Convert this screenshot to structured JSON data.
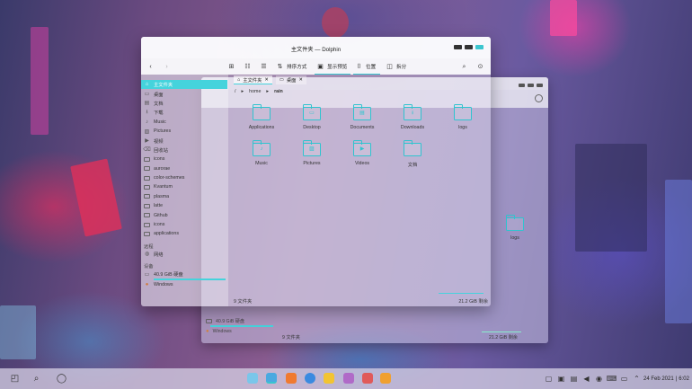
{
  "window": {
    "title": "主文件夹 — Dolphin",
    "controls": {
      "minimize": "minimize-icon",
      "maximize": "maximize-icon",
      "close": "close-icon"
    },
    "accent": "#45d3dc"
  },
  "toolbar": {
    "sort_label": "排序方式",
    "preview_label": "显示预览",
    "location_label": "位置",
    "split_label": "拆分"
  },
  "tabs": [
    {
      "label": "主文件夹"
    },
    {
      "label": "桌面"
    }
  ],
  "breadcrumb": {
    "root": "/",
    "items": [
      "home",
      "rain"
    ]
  },
  "sidebar": {
    "places": [
      {
        "label": "主文件夹",
        "icon": "home-icon",
        "active": true
      },
      {
        "label": "桌面",
        "icon": "desktop-icon"
      },
      {
        "label": "文档",
        "icon": "document-icon"
      },
      {
        "label": "下载",
        "icon": "download-icon"
      },
      {
        "label": "Music",
        "icon": "music-icon"
      },
      {
        "label": "Pictures",
        "icon": "picture-icon"
      },
      {
        "label": "视频",
        "icon": "video-icon"
      },
      {
        "label": "回收站",
        "icon": "trash-icon"
      },
      {
        "label": "icons",
        "icon": "folder-icon"
      },
      {
        "label": "aurorae",
        "icon": "folder-icon"
      },
      {
        "label": "color-schemes",
        "icon": "folder-icon"
      },
      {
        "label": "Kvantum",
        "icon": "folder-icon"
      },
      {
        "label": "plasma",
        "icon": "folder-icon"
      },
      {
        "label": "latte",
        "icon": "folder-icon"
      },
      {
        "label": "Github",
        "icon": "folder-icon"
      },
      {
        "label": "icons",
        "icon": "folder-icon"
      },
      {
        "label": "applications",
        "icon": "folder-icon"
      }
    ],
    "remote_label": "远程",
    "network_label": "网络",
    "devices_label": "设备",
    "devices": [
      {
        "label": "40.9 GiB 硬盘",
        "icon": "drive-icon"
      },
      {
        "label": "Windows",
        "icon": "windows-drive-icon"
      }
    ]
  },
  "files": [
    {
      "name": "Applications",
      "icon": "folder-icon"
    },
    {
      "name": "Desktop",
      "icon": "folder-desktop-icon"
    },
    {
      "name": "Documents",
      "icon": "folder-documents-icon"
    },
    {
      "name": "Downloads",
      "icon": "folder-downloads-icon"
    },
    {
      "name": "logs",
      "icon": "folder-icon"
    },
    {
      "name": "Music",
      "icon": "folder-music-icon"
    },
    {
      "name": "Pictures",
      "icon": "folder-pictures-icon"
    },
    {
      "name": "Videos",
      "icon": "folder-videos-icon"
    },
    {
      "name": "文档",
      "icon": "folder-icon"
    }
  ],
  "status": {
    "count": "9 文件夹",
    "free": "21.2 GiB 剩余"
  },
  "background_window": {
    "file": "logs",
    "devices": [
      "40.9 GiB 硬盘",
      "Windows"
    ],
    "count": "9 文件夹",
    "free": "21.2 GiB 剩余"
  },
  "taskbar": {
    "date": "24 Feb 2021",
    "time": "6:02"
  }
}
